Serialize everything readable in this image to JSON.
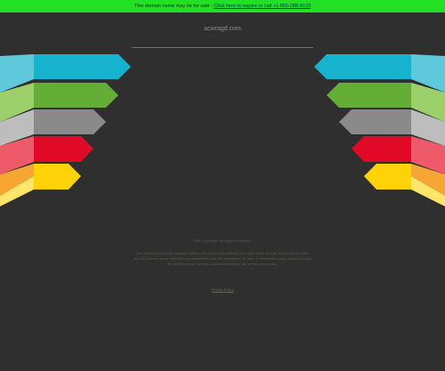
{
  "banner": {
    "text": "This domain name may be for sale",
    "link": "Click here to inquire or call +1-866-288-8133"
  },
  "domain": "acwragd.com",
  "footer": {
    "copyright": "2024 Copyright. All Rights Reserved.",
    "disclaimer": "The Sponsored Listings displayed above are served automatically by a third party. Neither the service provider nor the domain owner maintain any relationship with the advertisers. In case of trademark issues please contact the domain owner directly (contact information can be found in whois).",
    "privacy": "Privacy Policy"
  },
  "colors": {
    "background": "#2f2f2f",
    "banner": "#22e022",
    "stripes": [
      "#17b3ce",
      "#64ad36",
      "#8a8a8a",
      "#e00a28",
      "#ffd20a"
    ]
  }
}
